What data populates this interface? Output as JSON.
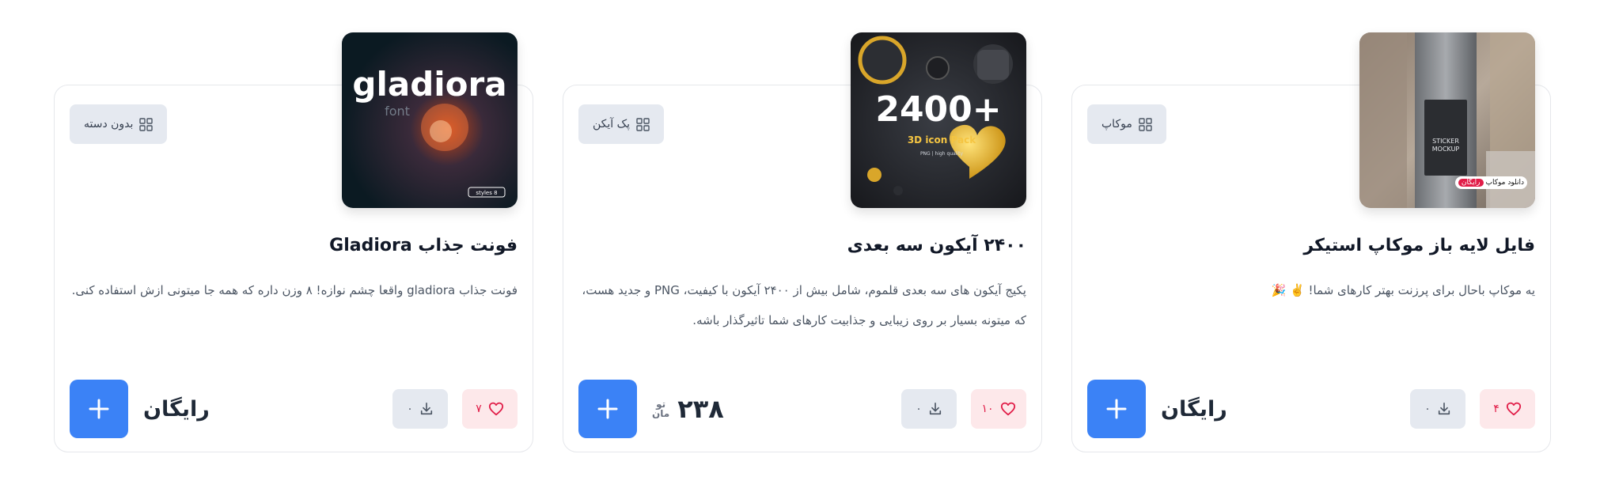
{
  "cards": [
    {
      "category": "موکاپ",
      "title": "فایل لایه باز موکاپ استیکر",
      "description": "یه موکاپ باحال برای پرزنت بهتر کارهای شما! ✌️ 🎉",
      "likes": "۴",
      "downloads": "۰",
      "price": "رایگان",
      "thumb_badge_text": "دانلود موکاپ",
      "thumb_badge_free": "رایگان",
      "thumb_label_1": "STICKER",
      "thumb_label_2": "MOCKUP"
    },
    {
      "category": "پک آیکن",
      "title": "۲۴۰۰ آیکون سه بعدی",
      "description": "پکیج آیکون های سه بعدی قلموم، شامل بیش از ۲۴۰۰ آیکون با کیفیت، PNG و جدید هست، که میتونه بسیار بر روی زیبایی و جذابیت کارهای شما تاثیرگذار باشه.",
      "likes": "۱۰",
      "downloads": "۰",
      "price": "۲۳۸",
      "currency_top": "تو",
      "currency_bottom": "مان",
      "thumb_big": "+2400",
      "thumb_sub": "3D icon Pack",
      "thumb_sub2": "PNG | high quality"
    },
    {
      "category": "بدون دسته",
      "title": "فونت جذاب Gladiora",
      "description": "فونت جذاب gladiora واقعا چشم نوازه! ۸ وزن داره که همه جا میتونی ازش استفاده کنی.",
      "likes": "۷",
      "downloads": "۰",
      "price": "رایگان",
      "thumb_word": "gladiora",
      "thumb_sub": "font",
      "thumb_tag": "8 styles"
    }
  ],
  "colors": {
    "accent": "#3b82f6",
    "like_bg": "#fde8ea",
    "like_fg": "#e11d48",
    "neutral_bg": "#e5e9f0"
  }
}
